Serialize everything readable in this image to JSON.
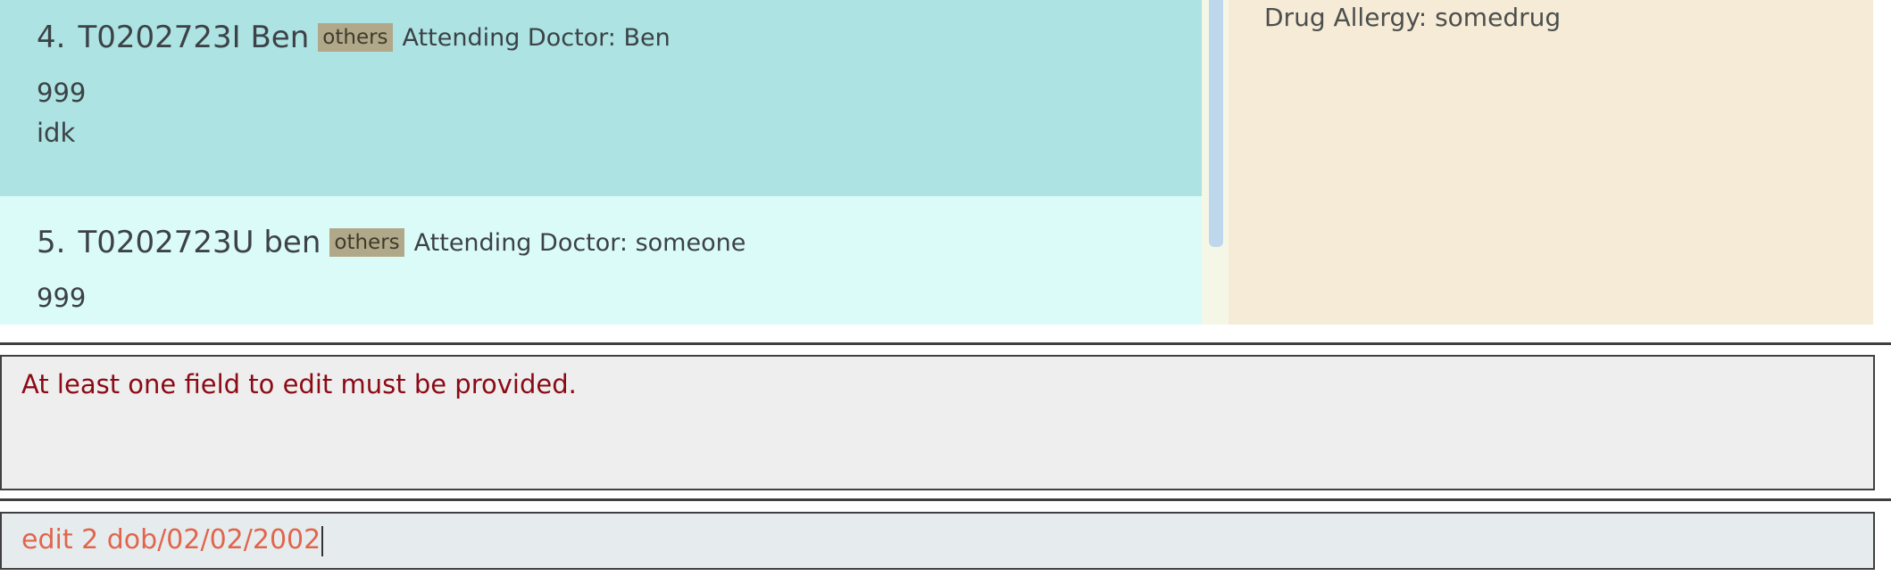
{
  "patient_list": {
    "items": [
      {
        "index": "4.",
        "name": "T0202723I Ben",
        "tag": "others",
        "doctor": "Attending Doctor: Ben",
        "lines": [
          "999",
          "idk"
        ]
      },
      {
        "index": "5.",
        "name": "T0202723U ben",
        "tag": "others",
        "doctor": "Attending Doctor: someone",
        "lines": [
          "999"
        ]
      }
    ]
  },
  "detail_panel": {
    "drug_allergy": "Drug Allergy: somedrug"
  },
  "result_display": {
    "message": "At least one field to edit must be provided."
  },
  "command_box": {
    "value": "edit 2 dob/02/02/2002"
  },
  "colors": {
    "selected_card": "#ade3e2",
    "card": "#dbfbf9",
    "tag": "#b1a88a",
    "detail_background": "#f5ebd6",
    "error_text": "#8b0a14",
    "command_text": "#e1654c"
  }
}
